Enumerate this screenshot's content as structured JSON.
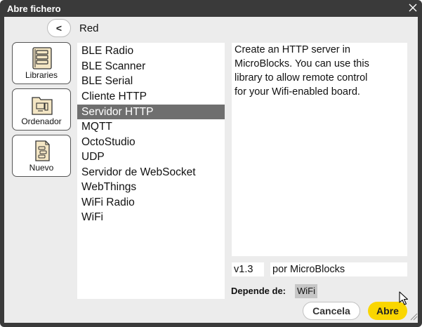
{
  "window": {
    "title": "Abre fichero"
  },
  "nav": {
    "back_label": "<",
    "path": "Red"
  },
  "sidebar": [
    {
      "label": "Libraries",
      "icon": "libraries-icon"
    },
    {
      "label": "Ordenador",
      "icon": "computer-folder-icon"
    },
    {
      "label": "Nuevo",
      "icon": "new-file-icon"
    }
  ],
  "libraries": [
    "BLE Radio",
    "BLE Scanner",
    "BLE Serial",
    "Cliente HTTP",
    "Servidor HTTP",
    "MQTT",
    "OctoStudio",
    "UDP",
    "Servidor de WebSocket",
    "WebThings",
    "WiFi Radio",
    "WiFi"
  ],
  "selected_index": 4,
  "details": {
    "description_lines": [
      "Create an HTTP server in",
      "MicroBlocks. You can use this",
      "library to allow remote control",
      "for your Wifi-enabled board."
    ],
    "version": "v1.3",
    "author": "por MicroBlocks",
    "depends_label": "Depende de:",
    "depends": "WiFi"
  },
  "buttons": {
    "cancel": "Cancela",
    "open": "Abre"
  },
  "colors": {
    "accent": "#fad600",
    "selected": "#6f6f6f",
    "frame": "#3a3a3a"
  }
}
